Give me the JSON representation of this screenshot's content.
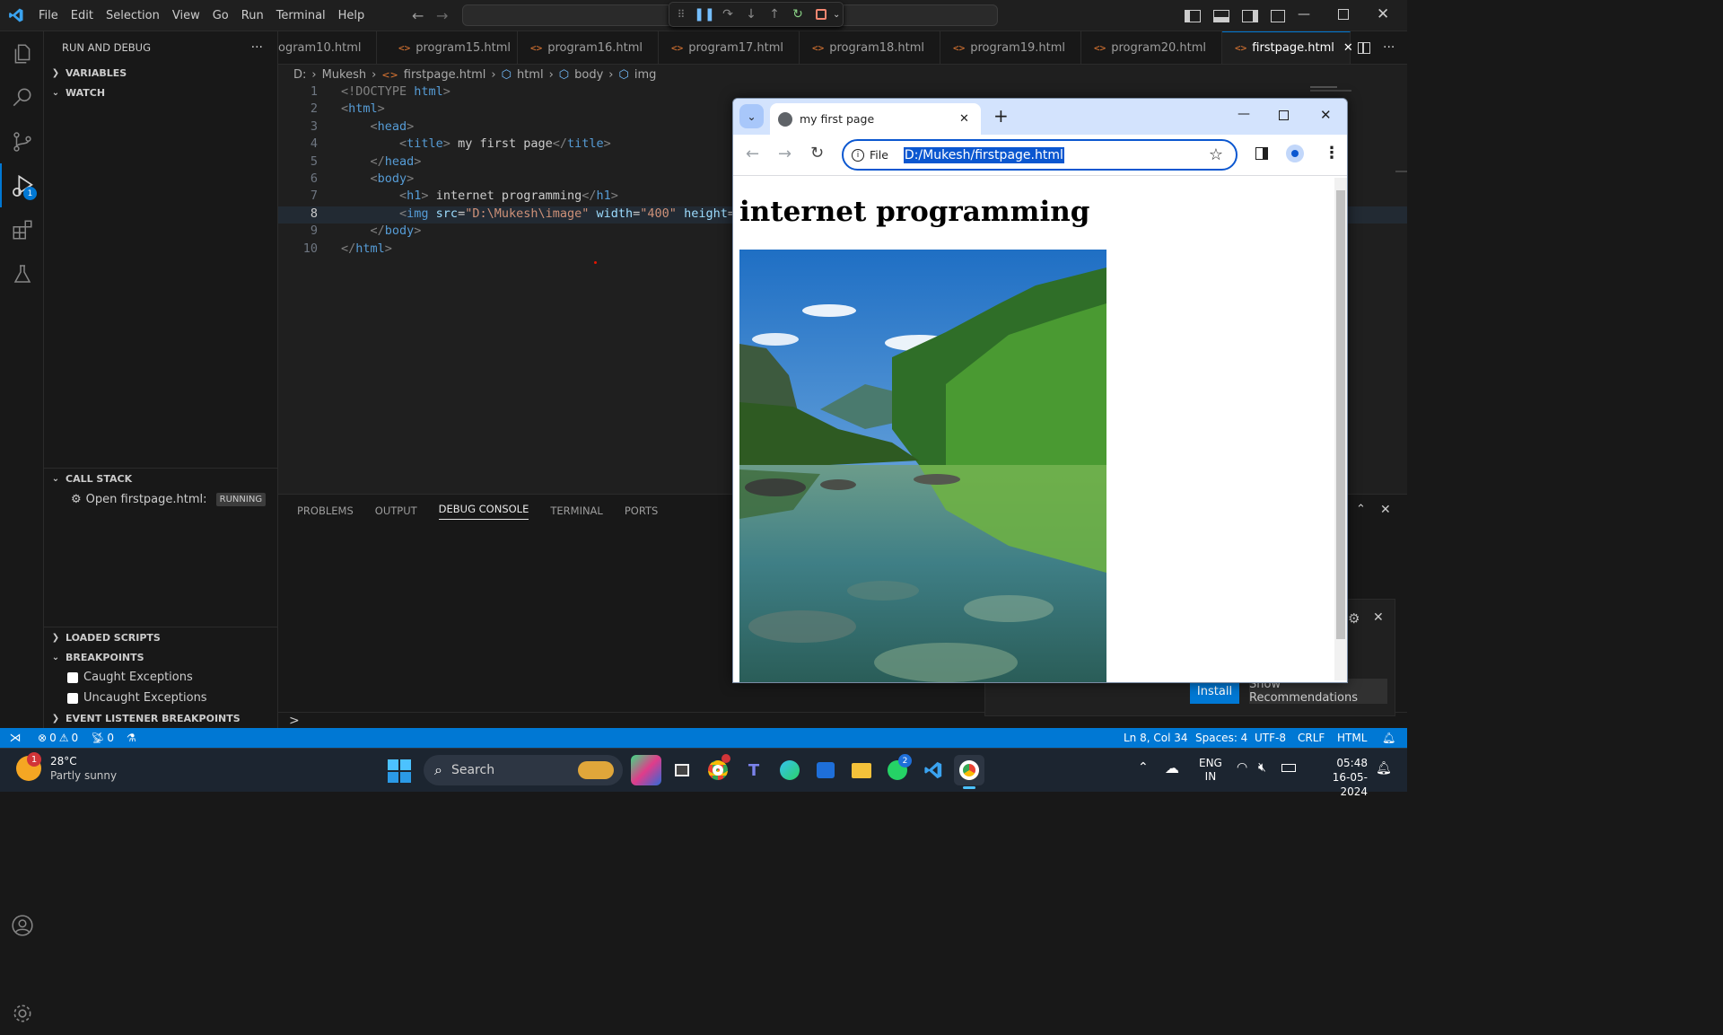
{
  "menu": [
    "File",
    "Edit",
    "Selection",
    "View",
    "Go",
    "Run",
    "Terminal",
    "Help"
  ],
  "sidebar": {
    "title": "RUN AND DEBUG",
    "more": "···",
    "variables": "VARIABLES",
    "watch": "WATCH",
    "call_stack": "CALL STACK",
    "call_stack_item": "Open firstpage.html: ...",
    "call_stack_status": "RUNNING",
    "loaded_scripts": "LOADED SCRIPTS",
    "breakpoints": "BREAKPOINTS",
    "bp_caught": "Caught Exceptions",
    "bp_uncaught": "Uncaught Exceptions",
    "event_listener": "EVENT LISTENER BREAKPOINTS",
    "debug_badge": "1"
  },
  "tabs": [
    {
      "label": "ogram10.html",
      "active": false
    },
    {
      "label": "program15.html",
      "active": false
    },
    {
      "label": "program16.html",
      "active": false
    },
    {
      "label": "program17.html",
      "active": false
    },
    {
      "label": "program18.html",
      "active": false
    },
    {
      "label": "program19.html",
      "active": false
    },
    {
      "label": "program20.html",
      "active": false
    },
    {
      "label": "firstpage.html",
      "active": true
    }
  ],
  "breadcrumbs": [
    "D:",
    "Mukesh",
    "firstpage.html",
    "html",
    "body",
    "img"
  ],
  "code": {
    "line_numbers": [
      "1",
      "2",
      "3",
      "4",
      "5",
      "6",
      "7",
      "8",
      "9",
      "10"
    ],
    "l1a": "<!DOCTYPE ",
    "l1b": "html",
    "l1c": ">",
    "l2a": "<",
    "l2b": "html",
    "l2c": ">",
    "l3a": "    <",
    "l3b": "head",
    "l3c": ">",
    "l4a": "        <",
    "l4b": "title",
    "l4c": ">",
    "l4d": " my first page",
    "l4e": "</",
    "l4f": "title",
    "l4g": ">",
    "l5a": "    </",
    "l5b": "head",
    "l5c": ">",
    "l6a": "    <",
    "l6b": "body",
    "l6c": ">",
    "l7a": "        <",
    "l7b": "h1",
    "l7c": ">",
    "l7d": " internet programming",
    "l7e": "</",
    "l7f": "h1",
    "l7g": ">",
    "l8a": "        <",
    "l8b": "img",
    "l8c": " src",
    "l8d": "=",
    "l8e": "\"D:\\Mukesh\\image\"",
    "l8f": " width",
    "l8g": "=",
    "l8h": "\"400\"",
    "l8i": " height",
    "l8j": "=",
    "l8k": "\"",
    "l9a": "    </",
    "l9b": "body",
    "l9c": ">",
    "l10a": "</",
    "l10b": "html",
    "l10c": ">"
  },
  "panel": {
    "tabs": [
      "PROBLEMS",
      "OUTPUT",
      "DEBUG CONSOLE",
      "TERMINAL",
      "PORTS"
    ],
    "active": "DEBUG CONSOLE",
    "prompt": ">"
  },
  "notification": {
    "install": "Install",
    "show_rec": "Show Recommendations"
  },
  "status": {
    "errors": "0",
    "warnings": "0",
    "ports": "0",
    "position": "Ln 8, Col 34",
    "spaces": "Spaces: 4",
    "encoding": "UTF-8",
    "eol": "CRLF",
    "language": "HTML"
  },
  "chrome": {
    "tab_title": "my first page",
    "scheme_label": "File",
    "url": "D:/Mukesh/firstpage.html",
    "heading": "internet programming"
  },
  "taskbar": {
    "weather_temp": "28°C",
    "weather_desc": "Partly sunny",
    "weather_badge": "1",
    "search": "Search",
    "chrome_badge": "",
    "whatsapp_badge": "2",
    "lang1": "ENG",
    "lang2": "IN",
    "time": "05:48",
    "date": "16-05-2024"
  },
  "colors": {
    "accent": "#0078d4",
    "status": "#0078d4",
    "chrome_tabbar": "#d3e3fd"
  }
}
